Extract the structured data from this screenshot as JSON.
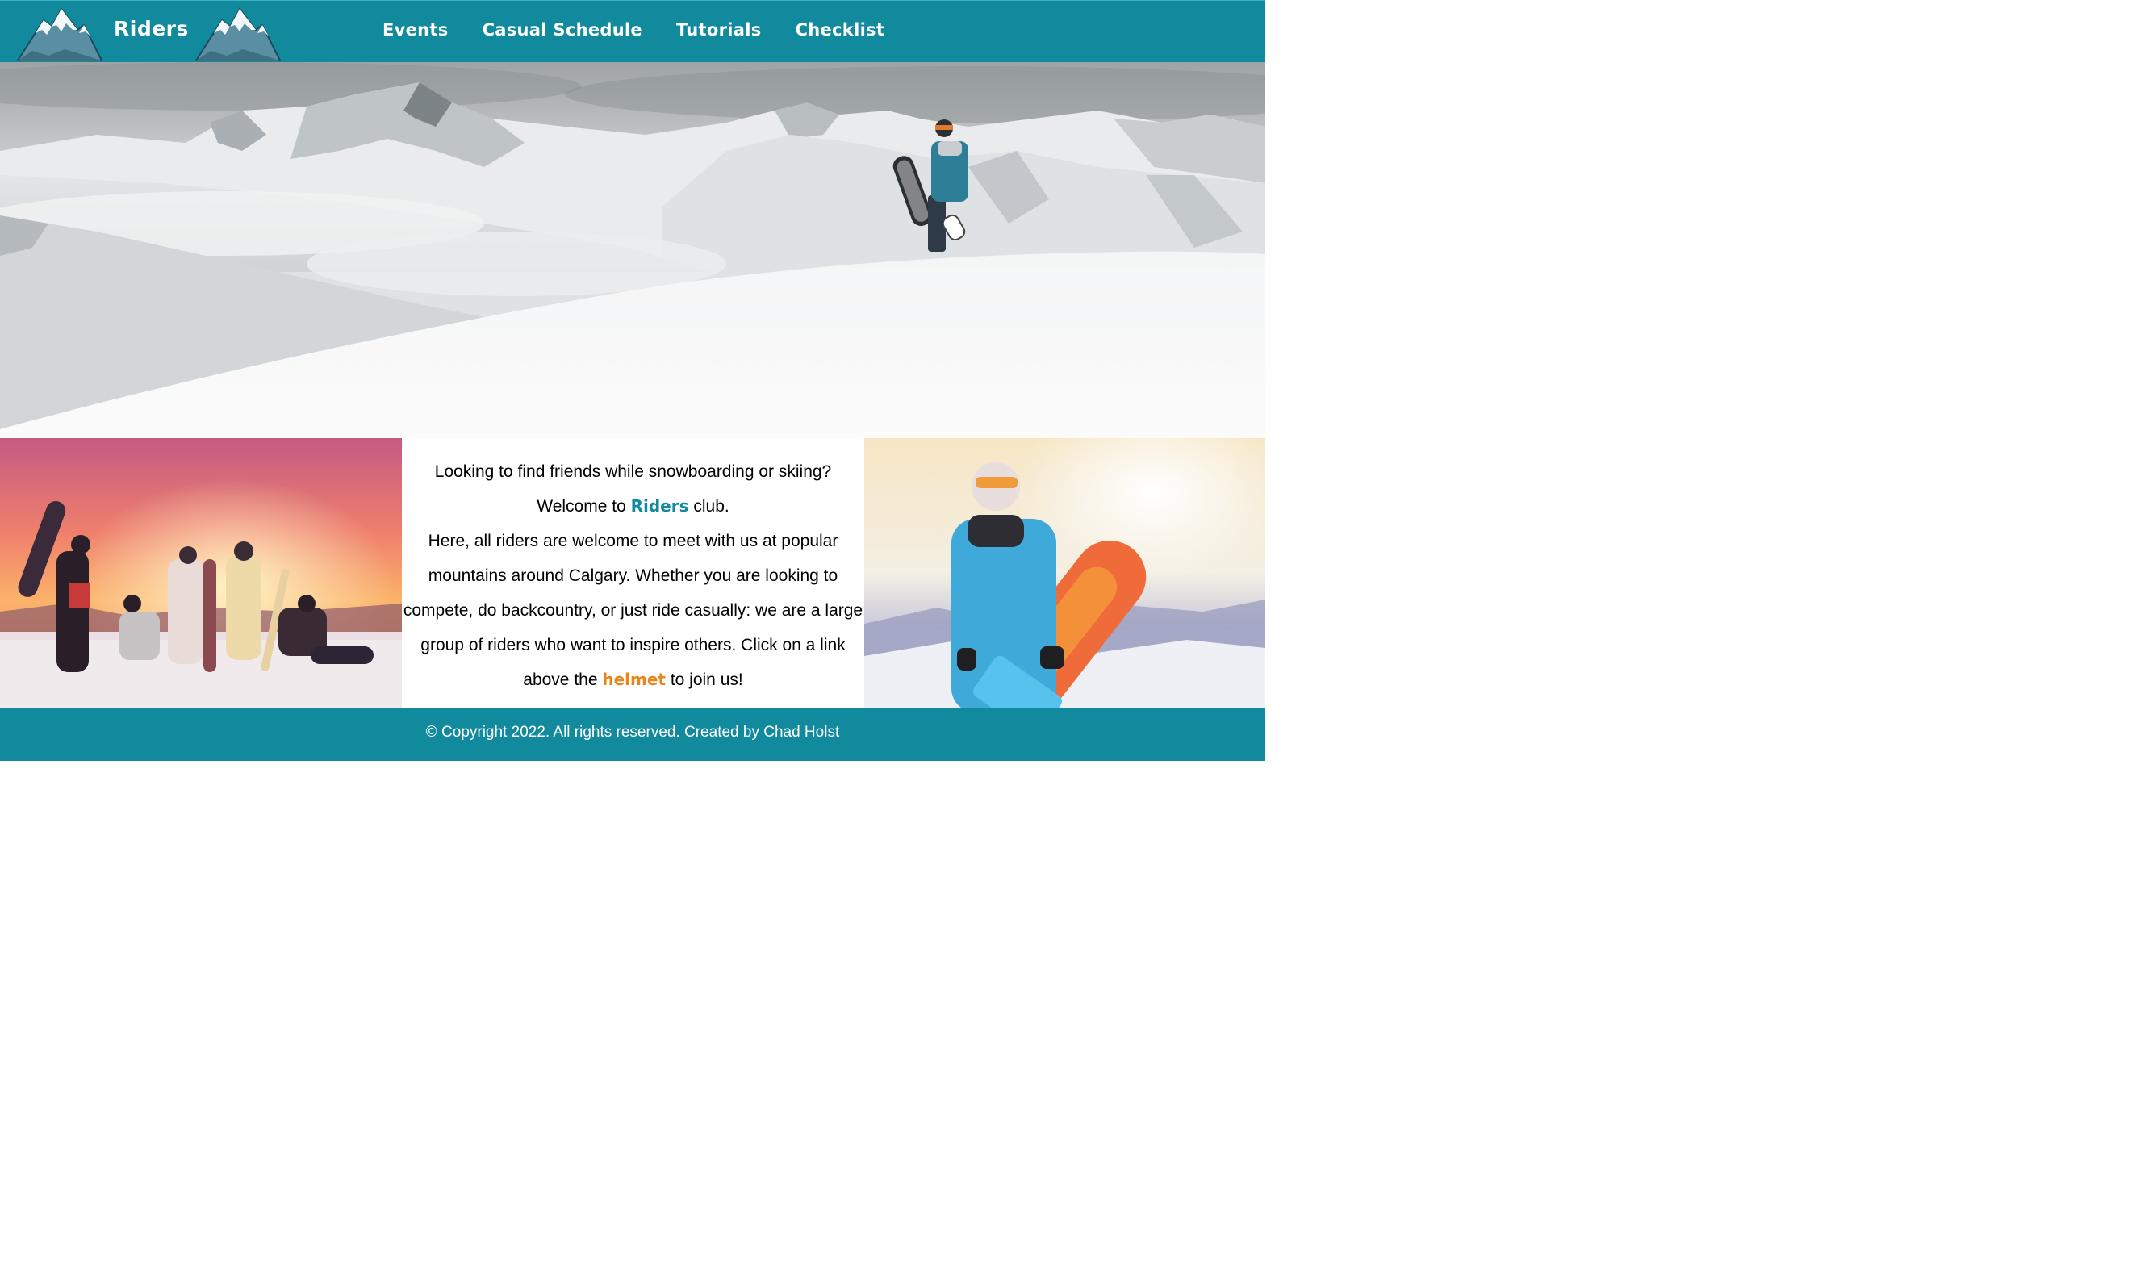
{
  "header": {
    "brand": "Riders",
    "nav": [
      {
        "label": "Events"
      },
      {
        "label": "Casual Schedule"
      },
      {
        "label": "Tutorials"
      },
      {
        "label": "Checklist"
      }
    ],
    "accent_color": "#128a9e"
  },
  "hero": {
    "image": "snowboarder-on-mountain-summit"
  },
  "intro": {
    "line1": "Looking to find friends while snowboarding or skiing?",
    "welcome_prefix": "Welcome to",
    "welcome_brand": "Riders",
    "welcome_suffix": "club.",
    "body_1": "Here, all riders are welcome to meet with us at popular mountains around Calgary. Whether you are looking to compete, do backcountry, or just ride casually: we are a large group of riders who want to inspire others. Click on a link above the",
    "helmet_link": "helmet",
    "body_2": "to join us!",
    "helmet_color": "#e8861a"
  },
  "photos": {
    "left": "group-of-riders-at-sunset",
    "right": "snowboarder-holding-orange-board"
  },
  "footer": {
    "text": "© Copyright 2022. All rights reserved. Created by Chad Holst"
  }
}
